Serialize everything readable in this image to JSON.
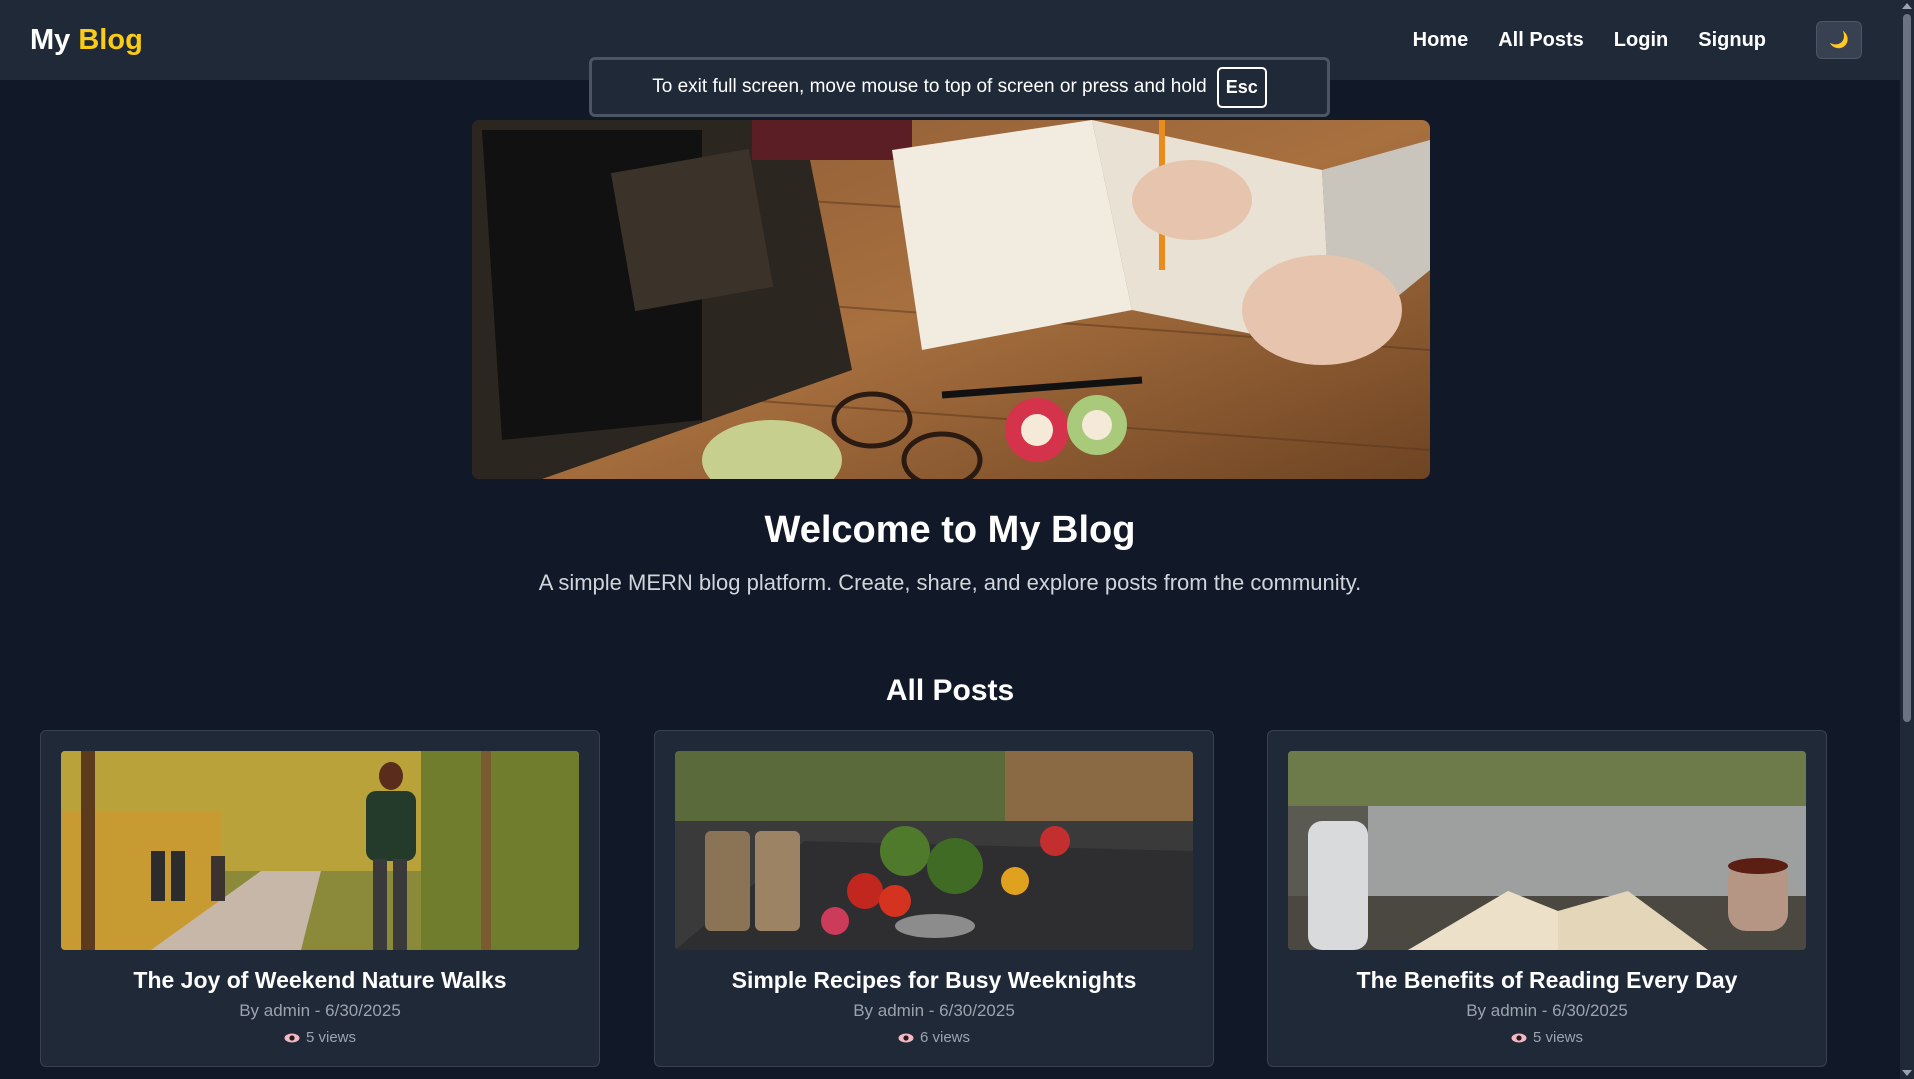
{
  "navbar": {
    "brand_primary": "My",
    "brand_accent": "Blog",
    "links": [
      "Home",
      "All Posts",
      "Login",
      "Signup"
    ],
    "theme_toggle_icon": "🌙"
  },
  "fullscreen_notice": {
    "text": "To exit full screen, move mouse to top of screen or press and hold",
    "key": "Esc"
  },
  "hero": {
    "title": "Welcome to My Blog",
    "subtitle": "A simple MERN blog platform. Create, share, and explore posts from the community."
  },
  "posts_section": {
    "title": "All Posts",
    "posts": [
      {
        "title": "The Joy of Weekend Nature Walks",
        "meta": "By admin - 6/30/2025",
        "views": "5 views"
      },
      {
        "title": "Simple Recipes for Busy Weeknights",
        "meta": "By admin - 6/30/2025",
        "views": "6 views"
      },
      {
        "title": "The Benefits of Reading Every Day",
        "meta": "By admin - 6/30/2025",
        "views": "5 views"
      }
    ]
  },
  "colors": {
    "background": "#111827",
    "navbar": "#1f2937",
    "accent": "#facc15"
  }
}
